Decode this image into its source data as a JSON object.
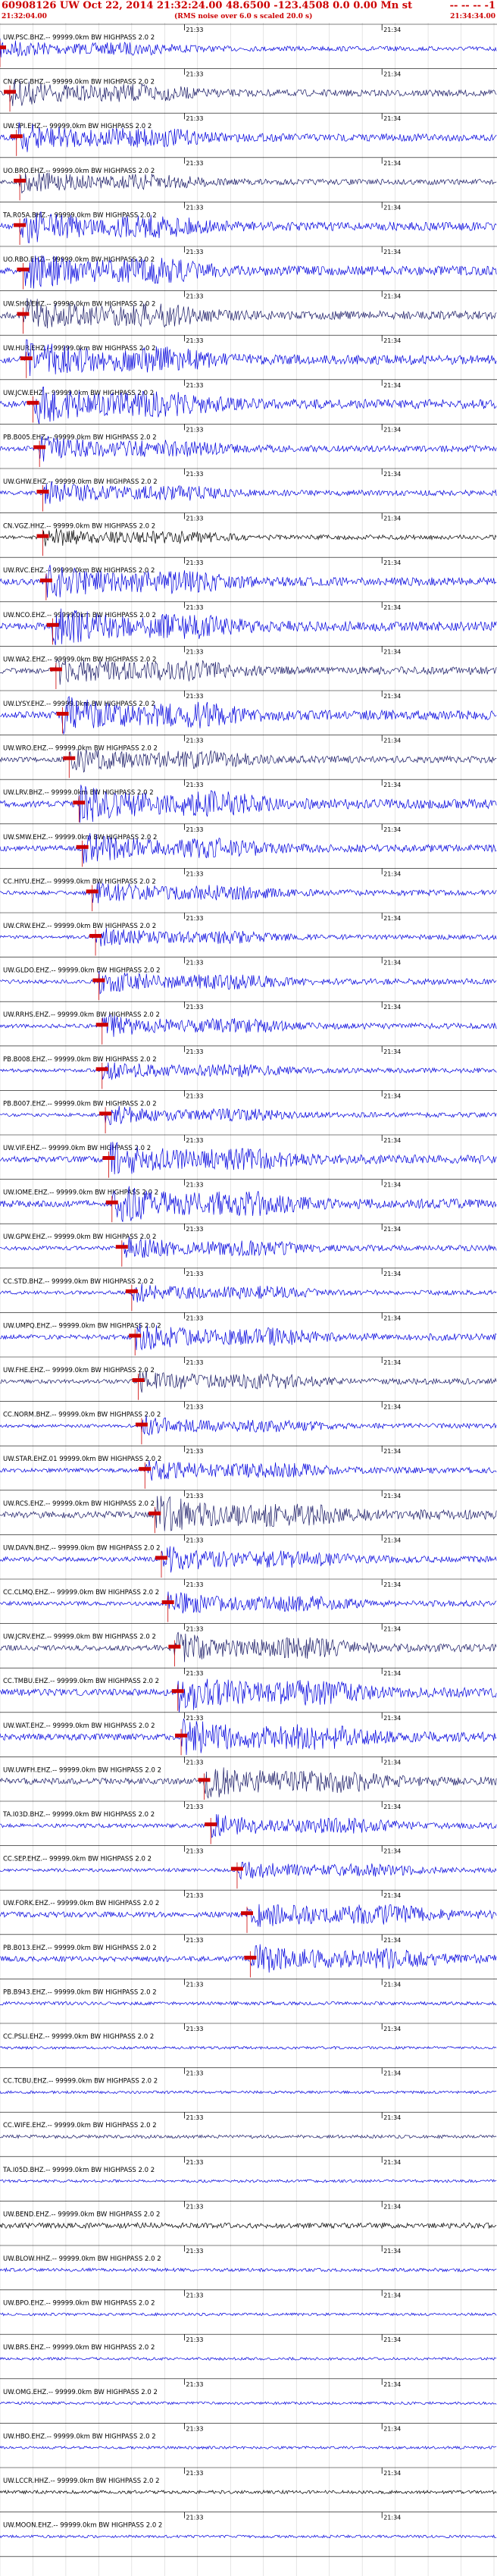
{
  "header": {
    "event_line": "60908126 UW Oct 22, 2014 21:32:24.00   48.6500  -123.4508   0.0 0.00 Mn st",
    "event_right": "-- -- --   -1",
    "start_time": "21:32:04.00",
    "rms_note": "(RMS noise over 6.0 s scaled 20.0 s)",
    "end_time": "21:34:34.00"
  },
  "time_ticks": [
    "21:33",
    "21:34"
  ],
  "colors": {
    "blue": "#0000dd",
    "dark": "#1a1a66",
    "black": "#000000",
    "pick": "#cc0000",
    "grid": "#000000"
  },
  "chart_data": {
    "type": "line",
    "title": "60908126 UW Oct 22, 2014 21:32:24.00 48.6500 -123.4508 0.0 0.00 Mn st",
    "x_range": [
      "21:32:04.00",
      "21:34:34.00"
    ],
    "grid": true,
    "traces": [
      {
        "label": "UW.PSC.BHZ.-- 99999.0km BW HIGHPASS 2.0 2",
        "pick_s": 0,
        "color": "blue",
        "amp": 0.5
      },
      {
        "label": "CN.PGC.BHZ.-- 99999.0km BW HIGHPASS 2.0 2",
        "pick_s": 3,
        "color": "dark",
        "amp": 0.7
      },
      {
        "label": "UW.SPI.EHZ.-- 99999.0km BW HIGHPASS 2.0 2",
        "pick_s": 5,
        "color": "blue",
        "amp": 0.8
      },
      {
        "label": "UO.BRO.EHZ.-- 99999.0km BW HIGHPASS 2.0 2",
        "pick_s": 6,
        "color": "dark",
        "amp": 0.6
      },
      {
        "label": "TA.R05A.BHZ.-- 99999.0km BW HIGHPASS 2.0 2",
        "pick_s": 6,
        "color": "blue",
        "amp": 0.9
      },
      {
        "label": "UO.RBO.EHZ.-- 99999.0km BW HIGHPASS 2.0 2",
        "pick_s": 7,
        "color": "blue",
        "amp": 1.0
      },
      {
        "label": "UW.SHO.EHZ.-- 99999.0km BW HIGHPASS 2.0 2",
        "pick_s": 7,
        "color": "dark",
        "amp": 0.9
      },
      {
        "label": "UW.HUR.EHZ.-- 99999.0km BW HIGHPASS 2.0 2",
        "pick_s": 8,
        "color": "blue",
        "amp": 1.0
      },
      {
        "label": "UW.JCW.EHZ.-- 99999.0km BW HIGHPASS 2.0 2",
        "pick_s": 10,
        "color": "blue",
        "amp": 1.0
      },
      {
        "label": "PB.B005.EHZ.-- 99999.0km BW HIGHPASS 2.0 2",
        "pick_s": 12,
        "color": "blue",
        "amp": 0.7
      },
      {
        "label": "UW.GHW.EHZ.-- 99999.0km BW HIGHPASS 2.0 2",
        "pick_s": 13,
        "color": "blue",
        "amp": 0.6
      },
      {
        "label": "CN.VGZ.HHZ.-- 99999.0km BW HIGHPASS 2.0 2",
        "pick_s": 13,
        "color": "black",
        "amp": 0.5
      },
      {
        "label": "UW.RVC.EHZ.-- 99999.0km BW HIGHPASS 2.0 2",
        "pick_s": 14,
        "color": "blue",
        "amp": 0.9
      },
      {
        "label": "UW.NCO.EHZ.-- 99999.0km BW HIGHPASS 2.0 2",
        "pick_s": 16,
        "color": "blue",
        "amp": 1.0
      },
      {
        "label": "UW.WA2.EHZ.-- 99999.0km BW HIGHPASS 2.0 2",
        "pick_s": 17,
        "color": "dark",
        "amp": 0.8
      },
      {
        "label": "UW.LYSY.EHZ.-- 99999.0km BW HIGHPASS 2.0 2",
        "pick_s": 19,
        "color": "blue",
        "amp": 1.0
      },
      {
        "label": "UW.WRO.EHZ.-- 99999.0km BW HIGHPASS 2.0 2",
        "pick_s": 21,
        "color": "dark",
        "amp": 0.7
      },
      {
        "label": "UW.LRV.BHZ.-- 99999.0km BW HIGHPASS 2.0 2",
        "pick_s": 24,
        "color": "blue",
        "amp": 1.0
      },
      {
        "label": "UW.SMW.EHZ.-- 99999.0km BW HIGHPASS 2.0 2",
        "pick_s": 25,
        "color": "blue",
        "amp": 0.8
      },
      {
        "label": "CC.HIYU.EHZ.-- 99999.0km BW HIGHPASS 2.0 2",
        "pick_s": 28,
        "color": "blue",
        "amp": 0.6
      },
      {
        "label": "UW.CRW.EHZ.-- 99999.0km BW HIGHPASS 2.0 2",
        "pick_s": 29,
        "color": "blue",
        "amp": 0.5
      },
      {
        "label": "UW.GLDO.EHZ.-- 99999.0km BW HIGHPASS 2.0 2",
        "pick_s": 30,
        "color": "blue",
        "amp": 0.6
      },
      {
        "label": "UW.RRHS.EHZ.-- 99999.0km BW HIGHPASS 2.0 2",
        "pick_s": 31,
        "color": "blue",
        "amp": 0.6
      },
      {
        "label": "PB.B008.EHZ.-- 99999.0km BW HIGHPASS 2.0 2",
        "pick_s": 31,
        "color": "blue",
        "amp": 0.5
      },
      {
        "label": "PB.B007.EHZ.-- 99999.0km BW HIGHPASS 2.0 2",
        "pick_s": 32,
        "color": "blue",
        "amp": 0.5
      },
      {
        "label": "UW.VIF.EHZ.-- 99999.0km BW HIGHPASS 2.0 2",
        "pick_s": 33,
        "color": "blue",
        "amp": 0.9
      },
      {
        "label": "UW.IOME.EHZ.-- 99999.0km BW HIGHPASS 2.0 2",
        "pick_s": 34,
        "color": "blue",
        "amp": 1.0
      },
      {
        "label": "UW.GPW.EHZ.-- 99999.0km BW HIGHPASS 2.0 2",
        "pick_s": 37,
        "color": "blue",
        "amp": 0.6
      },
      {
        "label": "CC.STD.BHZ.-- 99999.0km BW HIGHPASS 2.0 2",
        "pick_s": 40,
        "color": "blue",
        "amp": 0.5
      },
      {
        "label": "UW.UMPQ.EHZ.-- 99999.0km BW HIGHPASS 2.0 2",
        "pick_s": 41,
        "color": "blue",
        "amp": 0.7
      },
      {
        "label": "UW.FHE.EHZ.-- 99999.0km BW HIGHPASS 2.0 2",
        "pick_s": 42,
        "color": "dark",
        "amp": 0.6
      },
      {
        "label": "CC.NORM.BHZ.-- 99999.0km BW HIGHPASS 2.0 2",
        "pick_s": 43,
        "color": "blue",
        "amp": 0.5
      },
      {
        "label": "UW.STAR.EHZ.01 99999.0km BW HIGHPASS 2.0 2",
        "pick_s": 44,
        "color": "blue",
        "amp": 0.6
      },
      {
        "label": "UW.RCS.EHZ.-- 99999.0km BW HIGHPASS 2.0 2",
        "pick_s": 47,
        "color": "dark",
        "amp": 1.0
      },
      {
        "label": "UW.DAVN.BHZ.-- 99999.0km BW HIGHPASS 2.0 2",
        "pick_s": 49,
        "color": "blue",
        "amp": 0.7
      },
      {
        "label": "CC.CLMQ.EHZ.-- 99999.0km BW HIGHPASS 2.0 2",
        "pick_s": 51,
        "color": "blue",
        "amp": 0.6
      },
      {
        "label": "UW.JCRV.EHZ.-- 99999.0km BW HIGHPASS 2.0 2",
        "pick_s": 53,
        "color": "dark",
        "amp": 0.8
      },
      {
        "label": "CC.TMBU.EHZ.-- 99999.0km BW HIGHPASS 2.0 2",
        "pick_s": 54,
        "color": "blue",
        "amp": 1.0
      },
      {
        "label": "UW.WAT.EHZ.-- 99999.0km BW HIGHPASS 2.0 2",
        "pick_s": 55,
        "color": "blue",
        "amp": 1.0
      },
      {
        "label": "UW.UWFH.EHZ.-- 99999.0km BW HIGHPASS 2.0 2",
        "pick_s": 62,
        "color": "dark",
        "amp": 0.9
      },
      {
        "label": "TA.I03D.BHZ.-- 99999.0km BW HIGHPASS 2.0 2",
        "pick_s": 64,
        "color": "blue",
        "amp": 0.6
      },
      {
        "label": "CC.SEP.EHZ.-- 99999.0km BW HIGHPASS 2.0 2",
        "pick_s": 72,
        "color": "blue",
        "amp": 0.5
      },
      {
        "label": "UW.FORK.EHZ.-- 99999.0km BW HIGHPASS 2.0 2",
        "pick_s": 75,
        "color": "blue",
        "amp": 0.8
      },
      {
        "label": "PB.B013.EHZ.-- 99999.0km BW HIGHPASS 2.0 2",
        "pick_s": 76,
        "color": "blue",
        "amp": 0.8
      },
      {
        "label": "PB.B943.EHZ.-- 99999.0km BW HIGHPASS 2.0 2",
        "pick_s": null,
        "color": "blue",
        "amp": 0.5
      },
      {
        "label": "CC.PSLI.EHZ.-- 99999.0km BW HIGHPASS 2.0 2",
        "pick_s": null,
        "color": "blue",
        "amp": 0.4
      },
      {
        "label": "CC.TCBU.EHZ.-- 99999.0km BW HIGHPASS 2.0 2",
        "pick_s": null,
        "color": "blue",
        "amp": 0.4
      },
      {
        "label": "CC.WIFE.EHZ.-- 99999.0km BW HIGHPASS 2.0 2",
        "pick_s": null,
        "color": "dark",
        "amp": 0.5
      },
      {
        "label": "TA.I05D.BHZ.-- 99999.0km BW HIGHPASS 2.0 2",
        "pick_s": null,
        "color": "blue",
        "amp": 0.4
      },
      {
        "label": "UW.BEND.EHZ.-- 99999.0km BW HIGHPASS 2.0 2",
        "pick_s": null,
        "color": "black",
        "amp": 0.8
      },
      {
        "label": "UW.BLOW.HHZ.-- 99999.0km BW HIGHPASS 2.0 2",
        "pick_s": null,
        "color": "blue",
        "amp": 0.5
      },
      {
        "label": "UW.BPO.EHZ.-- 99999.0km BW HIGHPASS 2.0 2",
        "pick_s": null,
        "color": "blue",
        "amp": 0.4
      },
      {
        "label": "UW.BRS.EHZ.-- 99999.0km BW HIGHPASS 2.0 2",
        "pick_s": null,
        "color": "blue",
        "amp": 0.4
      },
      {
        "label": "UW.OMG.EHZ.-- 99999.0km BW HIGHPASS 2.0 2",
        "pick_s": null,
        "color": "blue",
        "amp": 0.4
      },
      {
        "label": "UW.HBO.EHZ.-- 99999.0km BW HIGHPASS 2.0 2",
        "pick_s": null,
        "color": "blue",
        "amp": 0.4
      },
      {
        "label": "UW.LCCR.HHZ.-- 99999.0km BW HIGHPASS 2.0 2",
        "pick_s": null,
        "color": "black",
        "amp": 0.5
      },
      {
        "label": "UW.MOON.EHZ.-- 99999.0km BW HIGHPASS 2.0 2",
        "pick_s": null,
        "color": "blue",
        "amp": 0.4
      }
    ]
  }
}
